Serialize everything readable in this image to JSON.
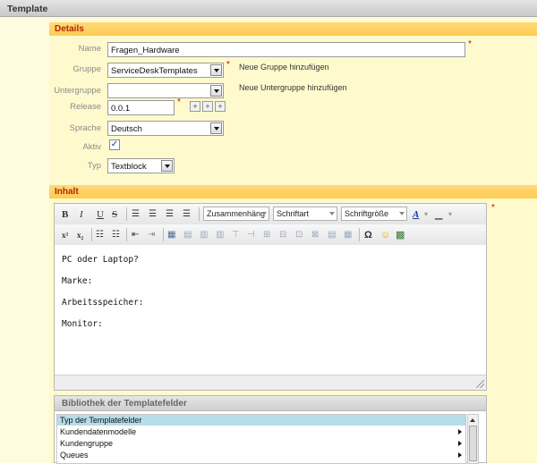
{
  "window": {
    "title": "Template"
  },
  "details": {
    "section_title": "Details",
    "name": {
      "label": "Name",
      "value": "Fragen_Hardware",
      "required": "*"
    },
    "gruppe": {
      "label": "Gruppe",
      "value": "ServiceDeskTemplates",
      "required": "*",
      "action": "Neue Gruppe hinzufügen"
    },
    "untergruppe": {
      "label": "Untergruppe",
      "value": "",
      "action": "Neue Untergruppe hinzufügen"
    },
    "release": {
      "label": "Release",
      "value": "0.0.1",
      "required": "*",
      "buttons": [
        "+",
        "+",
        "+"
      ]
    },
    "sprache": {
      "label": "Sprache",
      "value": "Deutsch"
    },
    "aktiv": {
      "label": "Aktiv",
      "checked": true,
      "mark": "✓"
    },
    "typ": {
      "label": "Typ",
      "value": "Textblock"
    }
  },
  "inhalt": {
    "section_title": "Inhalt",
    "required": "*",
    "toolbar": {
      "bold": "B",
      "italic": "I",
      "underline": "U",
      "strike": "S",
      "format_combo": "Zusammenhäng",
      "font_combo": "Schriftart",
      "size_combo": "Schriftgröße",
      "superscript": "x²",
      "subscript": "x₂",
      "omega": "Ω"
    },
    "content_lines": [
      "PC oder Laptop?",
      "Marke:",
      "Arbeitsspeicher:",
      "Monitor:"
    ]
  },
  "library": {
    "title": "Bibliothek der Templatefelder",
    "items": [
      "Typ der Templatefelder",
      "Kundendatenmodelle",
      "Kundengruppe",
      "Queues"
    ]
  },
  "colors": {
    "section_title": "#b02a00",
    "required": "#d40000",
    "selected_row": "#b6dcea",
    "panel": "#fffacd",
    "section_bar": "#ffcb52"
  }
}
